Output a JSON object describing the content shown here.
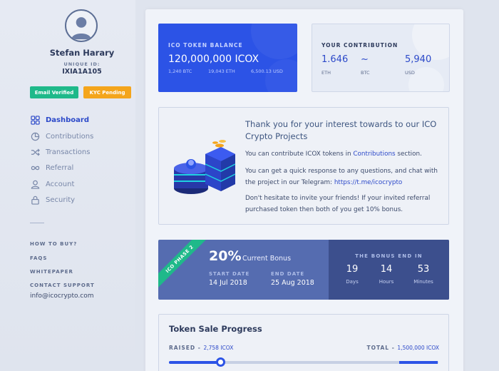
{
  "user": {
    "name": "Stefan Harary",
    "uid_label": "UNIQUE ID:",
    "uid": "IXIA1A105",
    "badges": {
      "email": "Email Verified",
      "kyc": "KYC Pending"
    }
  },
  "nav": {
    "items": [
      {
        "label": "Dashboard",
        "icon": "dashboard-icon",
        "active": true
      },
      {
        "label": "Contributions",
        "icon": "pie-chart-icon",
        "active": false
      },
      {
        "label": "Transactions",
        "icon": "shuffle-icon",
        "active": false
      },
      {
        "label": "Referral",
        "icon": "infinity-icon",
        "active": false
      },
      {
        "label": "Account",
        "icon": "user-icon",
        "active": false
      },
      {
        "label": "Security",
        "icon": "lock-icon",
        "active": false
      }
    ],
    "links": [
      "HOW TO BUY?",
      "FAQS",
      "WHITEPAPER",
      "CONTACT SUPPORT"
    ],
    "email": "info@icocrypto.com"
  },
  "balance": {
    "label": "ICO TOKEN BALANCE",
    "value": "120,000,000 ICOX",
    "sub": [
      "1,240 BTC",
      "19,043 ETH",
      "6,500.13 USD"
    ]
  },
  "contribution": {
    "label": "YOUR CONTRIBUTION",
    "items": [
      {
        "value": "1.646",
        "unit": "ETH"
      },
      {
        "value": "~",
        "unit": "BTC"
      },
      {
        "value": "5,940",
        "unit": "USD"
      }
    ]
  },
  "info": {
    "title": "Thank you for your interest towards to our ICO Crypto Projects",
    "p1_before": "You can contribute ICOX tokens in ",
    "p1_link": "Contributions",
    "p1_after": " section.",
    "p2_before": "You can get a quick response to any questions, and chat with the project in our Telegram: ",
    "p2_link": "https://t.me/icocrypto",
    "p3": "Don't hesitate to invite your friends! If your invited referral purchased token then both of you get 10% bonus."
  },
  "bonus": {
    "ribbon": "ICO PHASE 2",
    "percent": "20%",
    "label": "Current Bonus",
    "start_label": "START DATE",
    "start": "14 Jul 2018",
    "end_label": "END DATE",
    "end": "25 Aug 2018",
    "countdown_title": "THE BONUS END IN",
    "countdown": [
      {
        "num": "19",
        "unit": "Days"
      },
      {
        "num": "14",
        "unit": "Hours"
      },
      {
        "num": "53",
        "unit": "Minutes"
      }
    ]
  },
  "progress": {
    "title": "Token Sale Progress",
    "raised_label": "RAISED - ",
    "raised": "2,758 ICOX",
    "total_label": "TOTAL - ",
    "total": "1,500,000 ICOX",
    "fraction": 0.19
  },
  "colors": {
    "accent": "#2c53e6",
    "success": "#1fb98a",
    "warning": "#f4a51c",
    "bonus_bg": "#556cb0",
    "bonus_dark": "#3c4f8d"
  }
}
